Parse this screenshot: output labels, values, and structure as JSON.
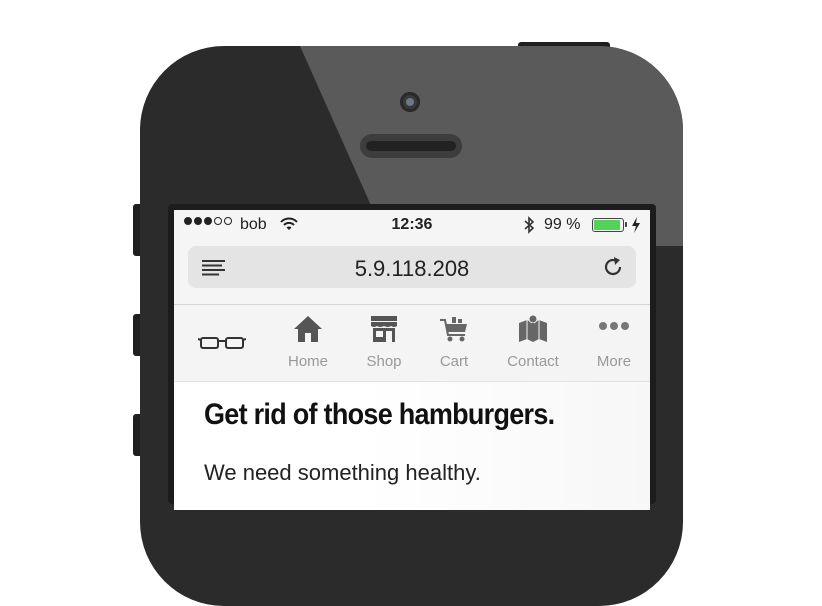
{
  "status_bar": {
    "signal_dots": 5,
    "signal_filled": 3,
    "carrier": "bob",
    "time": "12:36",
    "battery_percent": "99 %",
    "battery_level": 0.99,
    "battery_color": "#54d158"
  },
  "browser": {
    "url": "5.9.118.208",
    "menu_icon": "menu-icon",
    "reload_icon": "reload-icon"
  },
  "nav": {
    "logo_icon": "glasses-icon",
    "items": [
      {
        "label": "Home",
        "icon": "home-icon"
      },
      {
        "label": "Shop",
        "icon": "shop-icon"
      },
      {
        "label": "Cart",
        "icon": "cart-icon"
      },
      {
        "label": "Contact",
        "icon": "map-icon"
      },
      {
        "label": "More",
        "icon": "more-icon"
      }
    ]
  },
  "content": {
    "headline": "Get rid of those hamburgers.",
    "subline": "We need something healthy."
  }
}
